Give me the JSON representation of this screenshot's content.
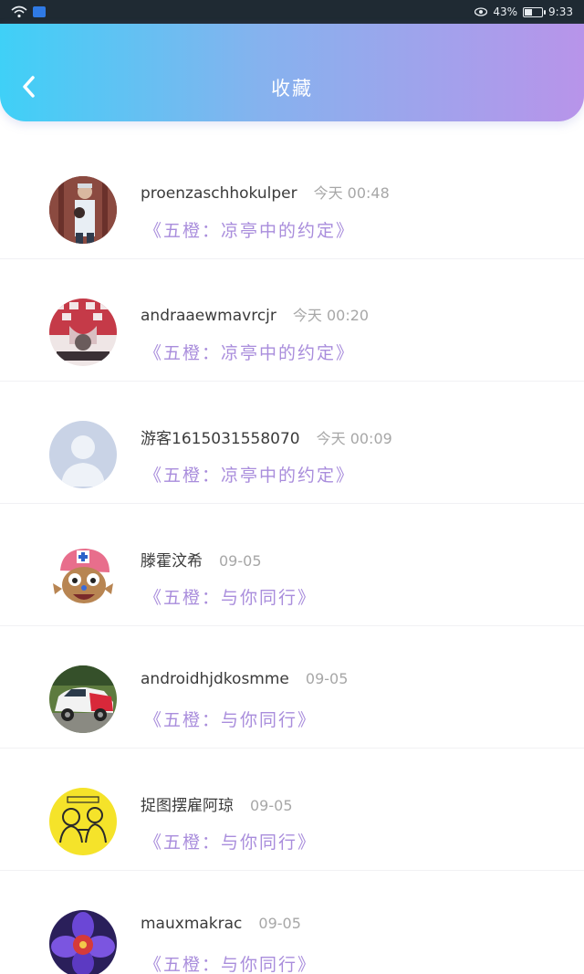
{
  "status_bar": {
    "battery_percent": "43%",
    "battery_level": 0.43,
    "clock": "9:33"
  },
  "header": {
    "title": "收藏",
    "back_icon": "chevron-left-icon"
  },
  "colors": {
    "header_gradient": [
      "#3fd0f7",
      "#86b2ee",
      "#b894ea"
    ],
    "work_title": "#a98ddc",
    "time": "#a7a7a7"
  },
  "favorites": [
    {
      "username": "proenzaschhokulper",
      "time": "今天 00:48",
      "work": "《五橙：凉亭中的约定》",
      "avatar": "photo-man-avatar"
    },
    {
      "username": "andraaewmavrcjr",
      "time": "今天 00:20",
      "work": "《五橙：凉亭中的约定》",
      "avatar": "photo-red-avatar"
    },
    {
      "username": "游客1615031558070",
      "time": "今天 00:09",
      "work": "《五橙：凉亭中的约定》",
      "avatar": "default-user-avatar"
    },
    {
      "username": "滕霍汶希",
      "time": "09-05",
      "work": "《五橙：与你同行》",
      "avatar": "cartoon-chopper-avatar"
    },
    {
      "username": "androidhjdkosmme",
      "time": "09-05",
      "work": "《五橙：与你同行》",
      "avatar": "rally-car-avatar"
    },
    {
      "username": "捉图摆雇阿琼",
      "time": "09-05",
      "work": "《五橙：与你同行》",
      "avatar": "yellow-sketch-avatar"
    },
    {
      "username": "mauxmakrac",
      "time": "09-05",
      "work": "《五橙：与你同行》",
      "avatar": "purple-flower-avatar"
    }
  ]
}
